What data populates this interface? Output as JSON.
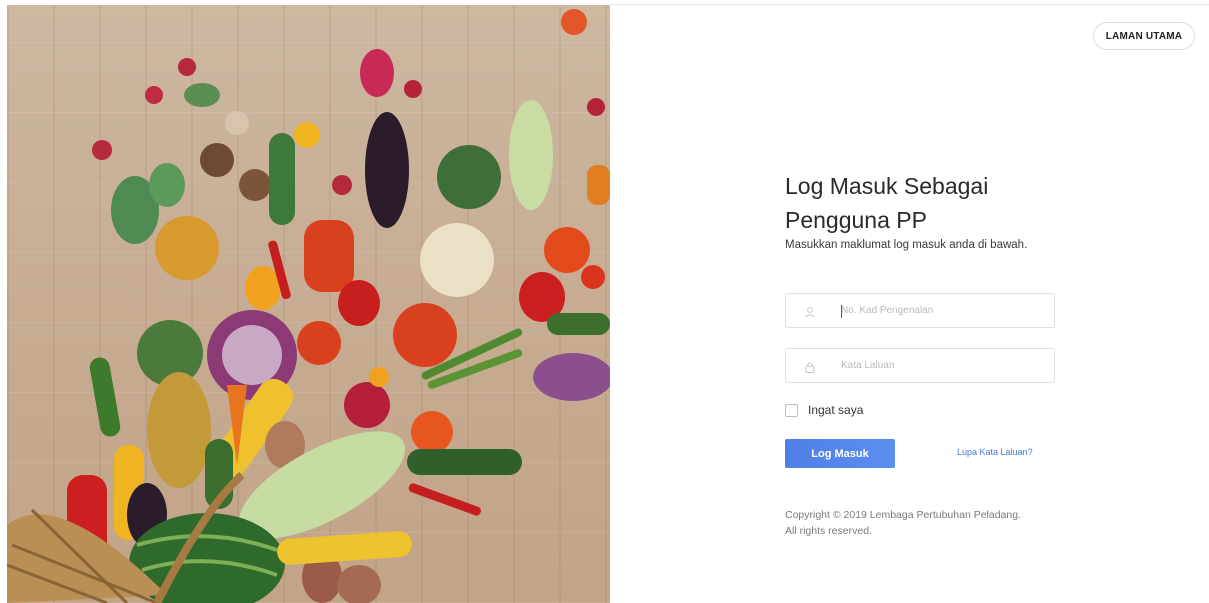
{
  "header": {
    "home_label": "LAMAN UTAMA"
  },
  "login": {
    "title_line1": "Log Masuk Sebagai",
    "title_line2": "Pengguna PP",
    "subtitle": "Masukkan maklumat log masuk anda di bawah.",
    "ic_placeholder": "No. Kad Pengenalan",
    "ic_value": "",
    "password_placeholder": "Kata Laluan",
    "password_value": "",
    "remember_label": "Ingat saya",
    "remember_checked": false,
    "submit_label": "Log Masuk",
    "forgot_label": "Lupa Kata Laluan?"
  },
  "footer": {
    "copyright_line1": "Copyright © 2019 Lembaga Pertubuhan Peladang.",
    "copyright_line2": "All rights reserved."
  },
  "icons": {
    "user_field": "user-icon",
    "password_field": "lock-icon"
  },
  "colors": {
    "accent": "#5585ec",
    "link": "#4a78e0",
    "border": "#dedede"
  }
}
